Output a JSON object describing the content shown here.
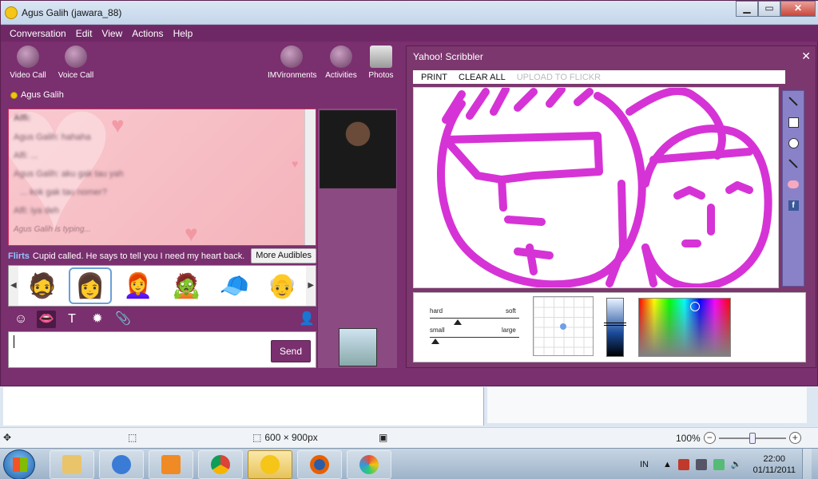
{
  "window": {
    "title": "Agus Galih (jawara_88)"
  },
  "window_controls": {
    "minimize": "▁",
    "maximize": "▭",
    "close": "✕"
  },
  "menu": [
    "Conversation",
    "Edit",
    "View",
    "Actions",
    "Help"
  ],
  "toolbar": {
    "video_call": "Video Call",
    "voice_call": "Voice Call",
    "imvironments": "IMVironments",
    "activities": "Activities",
    "photos": "Photos"
  },
  "contact": {
    "name": "Agus Galih",
    "status_color": "#f1c40f"
  },
  "conversation": {
    "lines": [
      "Alfi:",
      "Agus Galih: hahaha",
      "Alfi: ...",
      "Agus Galih: aku gak tau yah",
      "... kok gak tau nomer?",
      "Alfi: iya deh"
    ],
    "typing": "Agus Galih is typing..."
  },
  "flirts": {
    "tag": "Flirts",
    "text": "Cupid called. He says to tell you I need my heart back.",
    "more_button": "More Audibles"
  },
  "audibles": [
    "grumpy-man",
    "woman-green-dress",
    "red-hair-woman",
    "zombie-cowboy",
    "man-blue-cap",
    "old-man-glasses"
  ],
  "input": {
    "send": "Send"
  },
  "scribbler": {
    "title": "Yahoo! Scribbler",
    "menu": {
      "print": "PRINT",
      "clear": "CLEAR ALL",
      "upload": "UPLOAD TO FLICKR"
    },
    "brush": {
      "hard": "hard",
      "soft": "soft",
      "small": "small",
      "large": "large"
    },
    "ink_color": "#d633d6"
  },
  "paint_status": {
    "dimensions": "600 × 900px",
    "zoom": "100%"
  },
  "taskbar": {
    "apps": [
      "explorer",
      "internet-explorer",
      "media-player",
      "chrome",
      "yahoo-messenger",
      "firefox",
      "paint"
    ],
    "language": "IN",
    "time": "22:00",
    "date": "01/11/2011"
  }
}
